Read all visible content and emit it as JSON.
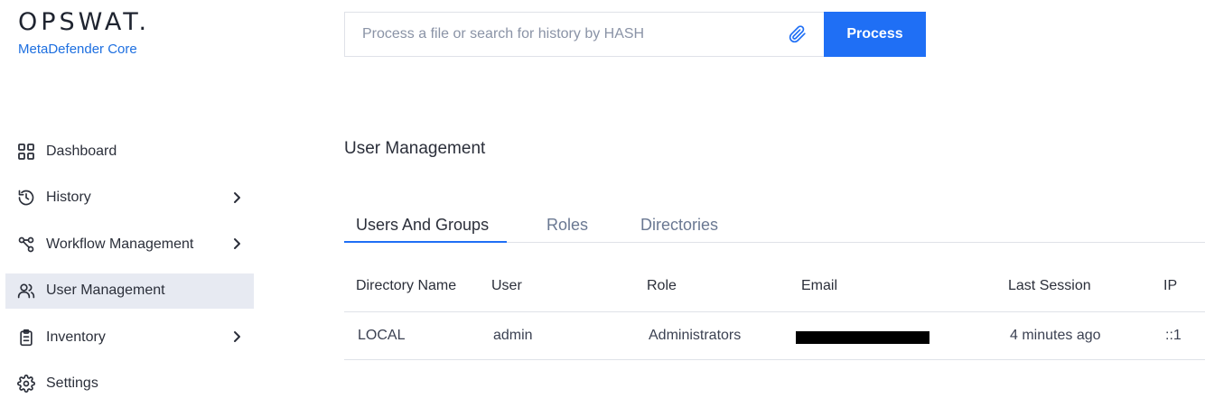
{
  "logo": {
    "wordmark": "OPSWAT.",
    "product": "MetaDefender Core"
  },
  "search": {
    "placeholder": "Process a file or search for history by HASH",
    "value": "",
    "attach_icon": "paperclip-icon",
    "process_label": "Process"
  },
  "sidebar": {
    "items": [
      {
        "label": "Dashboard",
        "icon": "grid-icon",
        "has_submenu": false,
        "active": false
      },
      {
        "label": "History",
        "icon": "history-icon",
        "has_submenu": true,
        "active": false
      },
      {
        "label": "Workflow Management",
        "icon": "workflow-icon",
        "has_submenu": true,
        "active": false
      },
      {
        "label": "User Management",
        "icon": "users-icon",
        "has_submenu": false,
        "active": true
      },
      {
        "label": "Inventory",
        "icon": "clipboard-icon",
        "has_submenu": true,
        "active": false
      },
      {
        "label": "Settings",
        "icon": "gear-icon",
        "has_submenu": false,
        "active": false
      }
    ]
  },
  "main": {
    "title": "User Management",
    "tabs": [
      {
        "label": "Users And Groups",
        "active": true
      },
      {
        "label": "Roles",
        "active": false
      },
      {
        "label": "Directories",
        "active": false
      }
    ],
    "table": {
      "columns": [
        "Directory Name",
        "User",
        "Role",
        "Email",
        "Last Session",
        "IP"
      ],
      "rows": [
        {
          "directory": "LOCAL",
          "user": "admin",
          "role": "Administrators",
          "email": "[redacted]",
          "last_session": "4 minutes ago",
          "ip": "::1"
        }
      ]
    }
  },
  "colors": {
    "accent": "#1f6ff5",
    "active_nav_bg": "#e7eaf2",
    "inactive_tab": "#6a7892",
    "border": "#dfe2e8"
  }
}
